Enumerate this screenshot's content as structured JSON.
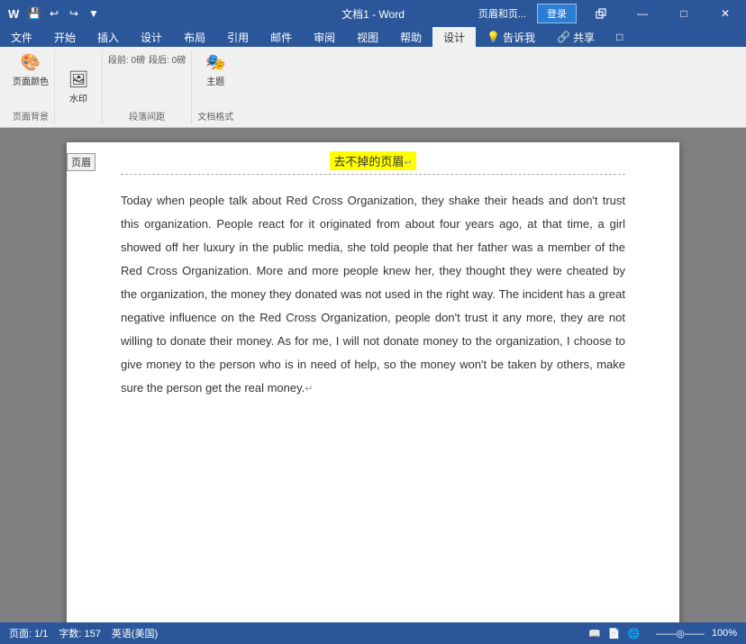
{
  "titlebar": {
    "app_icon": "W",
    "doc_title": "文档1 - Word",
    "ribbon_tabs_right": [
      "页眉和页...",
      "登录"
    ],
    "win_controls": [
      "—",
      "□",
      "✕"
    ],
    "qat": [
      "💾",
      "↩",
      "↪",
      "▼"
    ]
  },
  "ribbon": {
    "tabs": [
      "文件",
      "开始",
      "插入",
      "设计",
      "布局",
      "引用",
      "邮件",
      "审阅",
      "视图",
      "帮助",
      "设计",
      "💡 告诉我",
      "🔗 共享",
      "□"
    ]
  },
  "header_zone": {
    "label": "页眉",
    "title": "去不掉的页眉",
    "paragraph_mark": "↵"
  },
  "content": {
    "body_text": "Today when people talk about Red Cross Organization, they shake their heads and don't trust this organization. People react for it originated from about four years ago, at that time, a girl showed off her luxury in the public media, she told people that her father was a member of the Red Cross Organization. More and more people knew her, they thought they were cheated by the organization, the money they donated was not used in the right way. The incident has a great negative influence on the Red Cross Organization, people don't trust it any more, they are not willing to donate their money. As for me, I will not donate money to the organization, I choose to give money to the person who is in need of help, so the money won't be taken by others, make sure the person get the real money.",
    "end_mark": "↵"
  },
  "statusbar": {
    "page_info": "页面: 1/1",
    "word_count": "字数: 157",
    "language": "英语(美国)"
  },
  "colors": {
    "ribbon_blue": "#2b579a",
    "title_highlight": "yellow"
  }
}
